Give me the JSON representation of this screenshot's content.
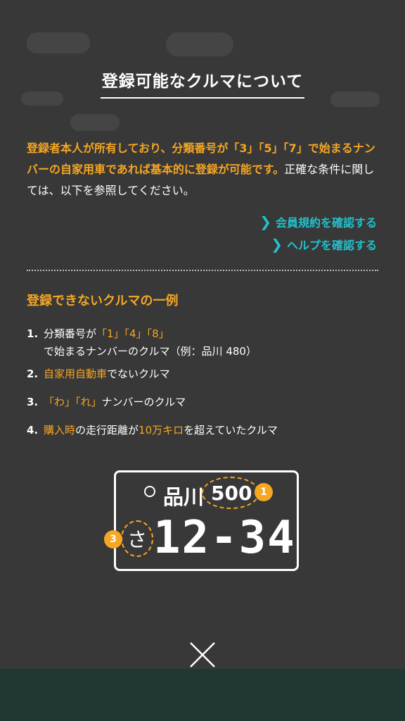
{
  "modal": {
    "title": "登録可能なクルマについて",
    "intro": {
      "highlight_1": "登録者本人が所有しており、分類番号が「3」「5」「7」で始まるナンバーの自家用車であれば基本的に登録が可能です。",
      "plain": "正確な条件に関しては、以下を参照してください。"
    },
    "links": [
      {
        "label": "会員規約を確認する"
      },
      {
        "label": "ヘルプを確認する"
      }
    ],
    "section_title": "登録できないクルマの一例",
    "list": [
      {
        "num": "1.",
        "p1": "分類番号が",
        "h1": "「1」「4」「8」",
        "p2": "で始まるナンバーのクルマ（例：品川 480）"
      },
      {
        "num": "2.",
        "h1": "自家用自動車",
        "p1": "でないクルマ"
      },
      {
        "num": "3.",
        "h1": "「わ」「れ」",
        "p1": "ナンバーのクルマ"
      },
      {
        "num": "4.",
        "h1": "購入時",
        "p1": "の走行距離が",
        "h2": "10万キロ",
        "p2": "を超えていたクルマ"
      }
    ],
    "plate": {
      "region": "品川",
      "class_number": "500",
      "kana": "さ",
      "number": "12-34",
      "badge_1": "1",
      "badge_3": "3"
    },
    "close_icon": "close-icon"
  },
  "colors": {
    "accent": "#f5a623",
    "link": "#22c1cc",
    "background": "#383838"
  }
}
